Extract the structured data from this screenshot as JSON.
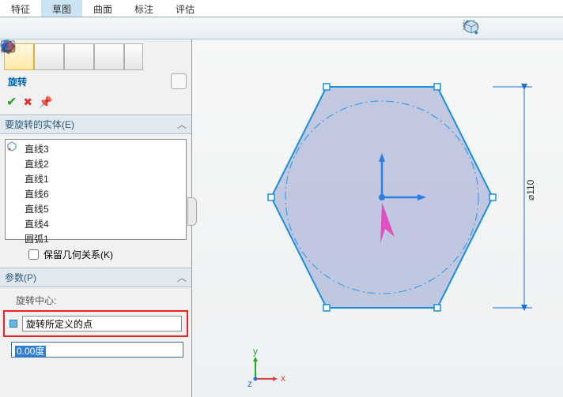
{
  "ribbon": {
    "tabs": [
      "特征",
      "草图",
      "曲面",
      "标注",
      "评估"
    ],
    "active": 1
  },
  "feature": {
    "title": "旋转",
    "ok": "✔",
    "cancel": "✖",
    "pin": "⇲",
    "help": "?"
  },
  "entities": {
    "header": "要旋转的实体(E)",
    "items": [
      "直线3",
      "直线2",
      "直线1",
      "直线6",
      "直线5",
      "直线4",
      "圆弧1"
    ],
    "keep_label": "保留几何关系(K)"
  },
  "params": {
    "header": "参数(P)",
    "center_label": "旋转中心:",
    "center_value": "旋转所定义的点",
    "angle_value": "0.00度"
  },
  "dim": {
    "label": "⌀110"
  },
  "axes": {
    "x": "x",
    "y": "y",
    "z": "z"
  },
  "icons": {
    "zoom_fit": "zoom-fit",
    "zoom_area": "zoom-area",
    "appearance": "appearance",
    "section": "section",
    "cube": "feature-cube",
    "props": "properties",
    "tree": "tree",
    "target": "target",
    "half": "half",
    "rotate": "rotate-icon",
    "listmark": "list-mark",
    "angle": "angle-icon"
  }
}
